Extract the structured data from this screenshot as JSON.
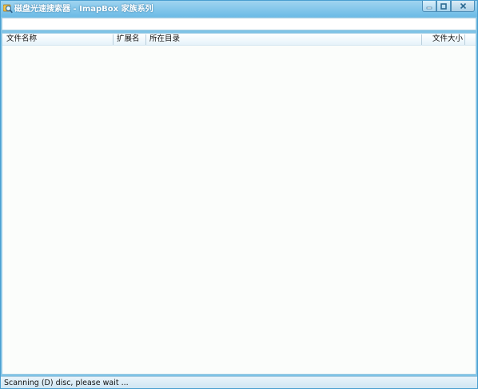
{
  "window": {
    "title": "磁盘光速搜索器 - ImapBox 家族系列",
    "icon": "magnifier-icon"
  },
  "controls": {
    "minimize": "minimize-icon",
    "maximize": "maximize-icon",
    "close": "close-icon"
  },
  "search": {
    "value": "",
    "placeholder": ""
  },
  "list": {
    "columns": [
      "文件名称",
      "扩展名",
      "所在目录",
      "文件大小"
    ],
    "rows": []
  },
  "status": {
    "text": "Scanning (D) disc, please wait ..."
  },
  "colors": {
    "titlebar": "#6cbbe6",
    "frame": "#7fc3e6",
    "list_background": "#fbfdfb",
    "header_background": "#e6f3fa"
  }
}
